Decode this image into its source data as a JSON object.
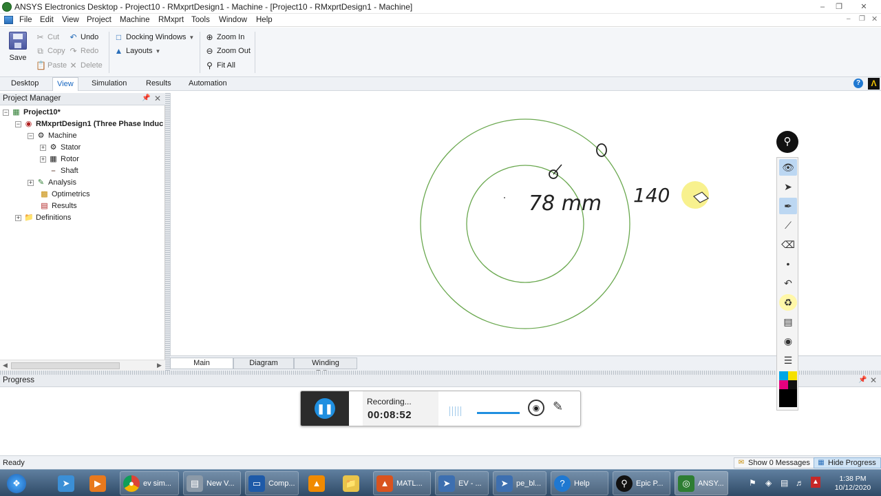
{
  "window": {
    "title": "ANSYS Electronics Desktop - Project10 - RMxprtDesign1 - Machine - [Project10 - RMxprtDesign1 - Machine]"
  },
  "menu": [
    "File",
    "Edit",
    "View",
    "Project",
    "Machine",
    "RMxprt",
    "Tools",
    "Window",
    "Help"
  ],
  "ribbon": {
    "save": "Save",
    "cut": "Cut",
    "copy": "Copy",
    "paste": "Paste",
    "undo": "Undo",
    "redo": "Redo",
    "delete": "Delete",
    "docking_windows": "Docking Windows",
    "layouts": "Layouts",
    "zoom_in": "Zoom In",
    "zoom_out": "Zoom Out",
    "fit_all": "Fit All"
  },
  "ribbon_tabs": [
    "Desktop",
    "View",
    "Simulation",
    "Results",
    "Automation"
  ],
  "active_ribbon_tab": "View",
  "project_manager": {
    "title": "Project Manager",
    "tree": {
      "project": "Project10*",
      "design": "RMxprtDesign1 (Three Phase Induc",
      "machine": "Machine",
      "stator": "Stator",
      "rotor": "Rotor",
      "shaft": "Shaft",
      "analysis": "Analysis",
      "optimetrics": "Optimetrics",
      "results": "Results",
      "definitions": "Definitions"
    }
  },
  "canvas": {
    "annotations": [
      "78 mm",
      "140"
    ],
    "tabs": [
      "Main",
      "Diagram",
      "Winding Editor"
    ],
    "stroke_color": "#6aa84f"
  },
  "progress": {
    "title": "Progress"
  },
  "recorder": {
    "label": "Recording...",
    "time": "00:08:52"
  },
  "status": {
    "ready": "Ready",
    "show_messages": "Show 0 Messages",
    "hide_progress": "Hide Progress"
  },
  "taskbar": {
    "items": [
      "ev sim...",
      "New V...",
      "Comp...",
      "MATL...",
      "EV - ...",
      "pe_bl...",
      "Help",
      "Epic P...",
      "ANSY..."
    ],
    "time": "1:38 PM",
    "date": "10/12/2020"
  },
  "colors": {
    "accent": "#1565c0",
    "recorder_blue": "#1f8fe0",
    "circle_green": "#6aa84f"
  }
}
